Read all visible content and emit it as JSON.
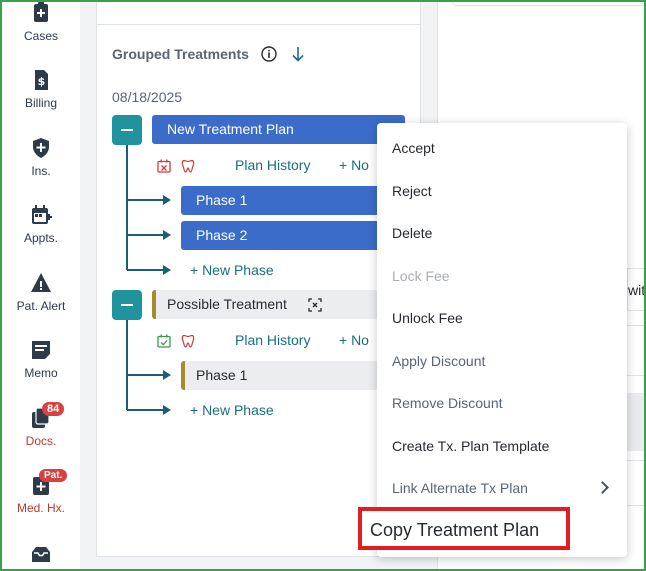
{
  "sidebar": {
    "items": [
      {
        "label": "Cases",
        "icon": "clipboard-plus-icon"
      },
      {
        "label": "Billing",
        "icon": "dollar-document-icon"
      },
      {
        "label": "Ins.",
        "icon": "shield-plus-icon"
      },
      {
        "label": "Appts.",
        "icon": "calendar-plus-icon"
      },
      {
        "label": "Pat. Alert",
        "icon": "alert-triangle-icon"
      },
      {
        "label": "Memo",
        "icon": "memo-icon"
      },
      {
        "label": "Docs.",
        "icon": "documents-icon",
        "badge": "84"
      },
      {
        "label": "Med. Hx.",
        "icon": "medical-history-icon",
        "badge": "Pat."
      },
      {
        "label": "",
        "icon": "inbox-icon"
      }
    ]
  },
  "panel": {
    "heading": "Grouped Treatments",
    "date": "08/18/2025"
  },
  "plans": [
    {
      "name": "New Treatment Plan",
      "plan_history": "Plan History",
      "note_link": "+ No",
      "phases": [
        "Phase 1",
        "Phase 2"
      ],
      "new_phase": "+ New Phase"
    },
    {
      "name": "Possible Treatment",
      "plan_history": "Plan History",
      "note_link": "+ No",
      "phases": [
        "Phase 1"
      ],
      "new_phase": "+ New Phase"
    }
  ],
  "context_menu": {
    "items": [
      {
        "label": "Accept",
        "state": "enabled"
      },
      {
        "label": "Reject",
        "state": "enabled"
      },
      {
        "label": "Delete",
        "state": "enabled"
      },
      {
        "label": "Lock Fee",
        "state": "disabled"
      },
      {
        "label": "Unlock Fee",
        "state": "enabled"
      },
      {
        "label": "Apply Discount",
        "state": "muted"
      },
      {
        "label": "Remove Discount",
        "state": "muted"
      },
      {
        "label": "Create Tx. Plan Template",
        "state": "enabled"
      },
      {
        "label": "Link Alternate Tx Plan",
        "state": "muted",
        "submenu": true
      },
      {
        "label": "Copy Treatment Plan",
        "state": "highlighted"
      }
    ]
  },
  "right_panel": {
    "partial_text": "wit"
  },
  "colors": {
    "accent_teal": "#21939e",
    "plan_blue": "#3b6cc9",
    "highlight_red": "#e01e23",
    "badge_red": "#d94040",
    "link_teal": "#1b6e7d"
  }
}
